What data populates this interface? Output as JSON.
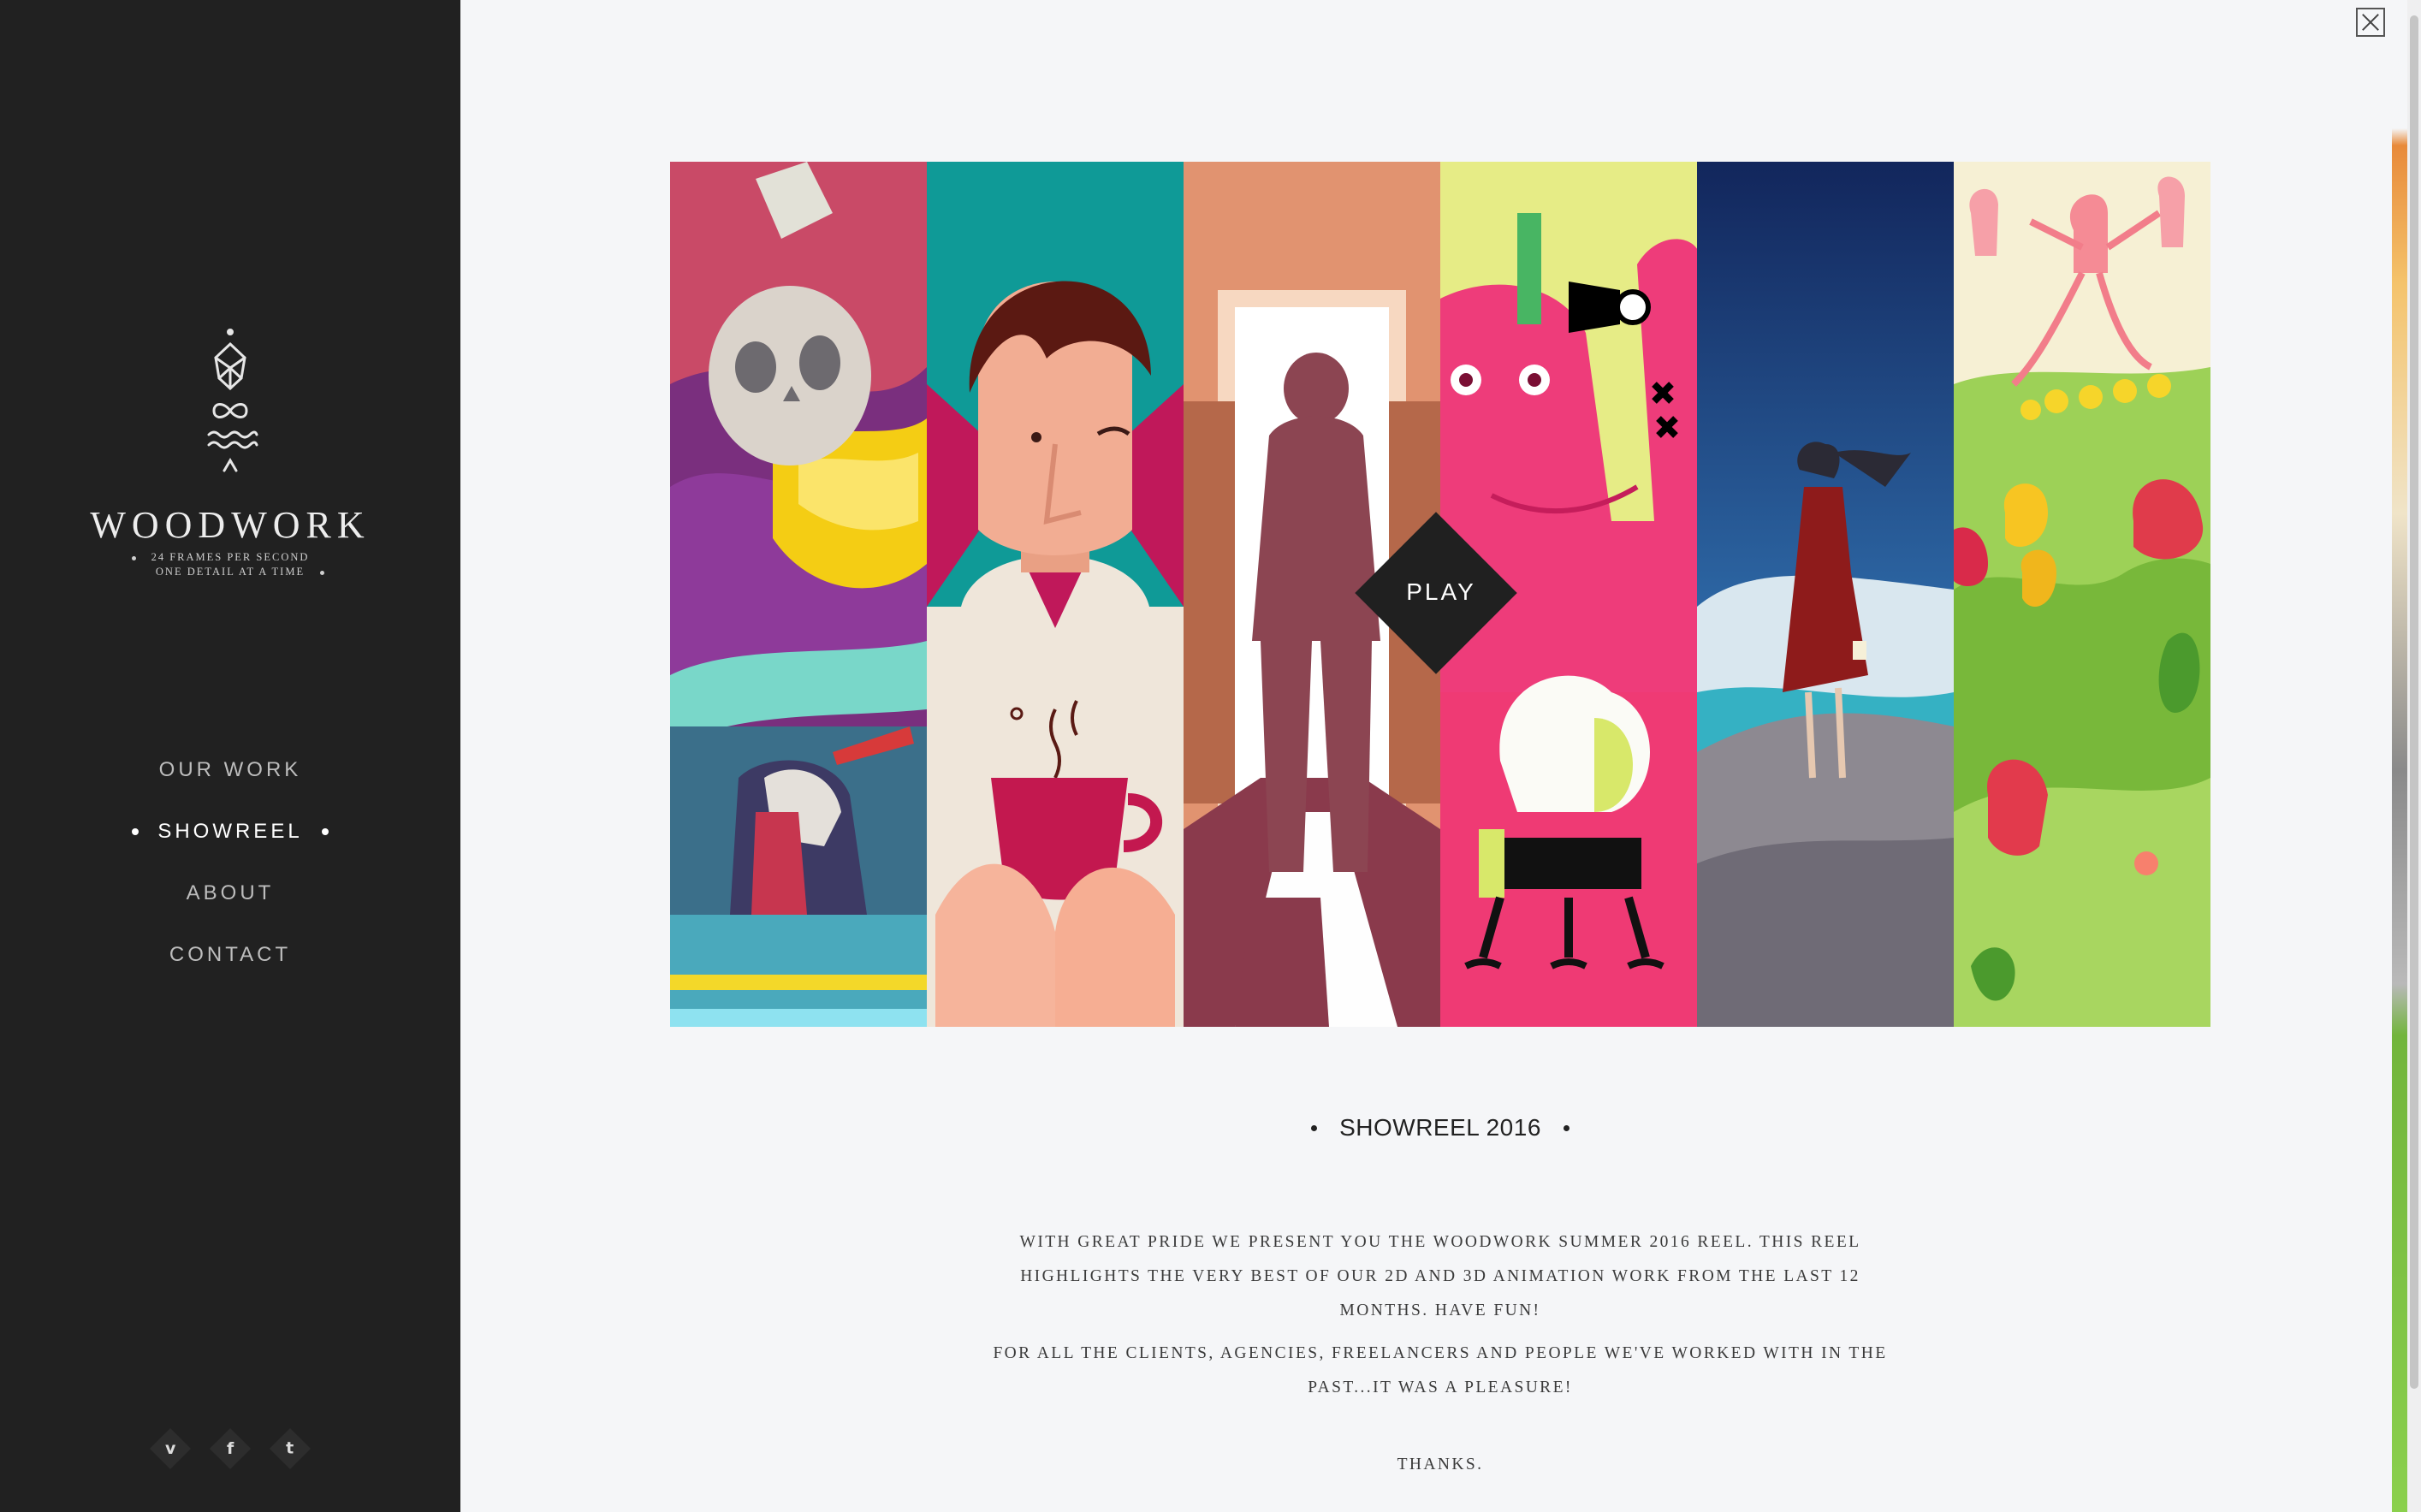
{
  "sidebar": {
    "brand": "WOODWORK",
    "tagline_1": "24 FRAMES PER SECOND",
    "tagline_2": "ONE DETAIL AT A TIME",
    "nav": {
      "our_work": "OUR WORK",
      "showreel": "SHOWREEL",
      "about": "ABOUT",
      "contact": "CONTACT"
    },
    "social": {
      "vimeo": "v",
      "facebook": "f",
      "twitter": "t"
    }
  },
  "main": {
    "play_label": "PLAY",
    "title": "SHOWREEL 2016",
    "paragraph_1": "WITH GREAT PRIDE WE PRESENT YOU THE WOODWORK SUMMER 2016 REEL. THIS REEL HIGHLIGHTS THE VERY BEST OF OUR 2D AND 3D ANIMATION WORK FROM THE LAST 12 MONTHS. HAVE FUN!",
    "paragraph_2": "FOR ALL THE CLIENTS, AGENCIES, FREELANCERS AND PEOPLE WE'VE WORKED WITH IN THE PAST...IT WAS A PLEASURE!",
    "paragraph_3": "THANKS."
  },
  "icons": [
    "woodwork-logo-icon",
    "vimeo-icon",
    "facebook-icon",
    "twitter-icon",
    "close-icon",
    "play-icon"
  ],
  "colors": {
    "sidebar_bg": "#212121",
    "page_bg": "#f5f6f8",
    "play_bg": "#202020"
  }
}
